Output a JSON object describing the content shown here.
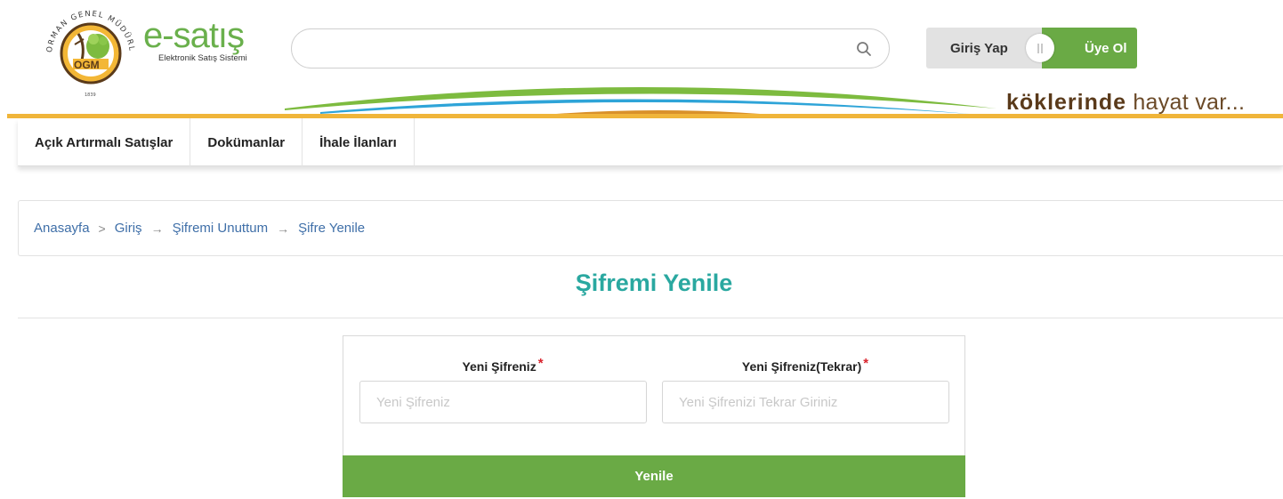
{
  "header": {
    "logo": {
      "emblem_text_top": "ORMAN GENEL MÜDÜRLÜĞÜ",
      "emblem_abbr": "OGM",
      "emblem_year": "1839",
      "brand": "e-satış",
      "subtitle": "Elektronik Satış Sistemi"
    },
    "search": {
      "value": "",
      "placeholder": "",
      "icon": "search-icon"
    },
    "auth": {
      "login_label": "Giriş Yap",
      "register_label": "Üye Ol"
    },
    "slogan": {
      "bold": "köklerinde",
      "light": "hayat var..."
    },
    "colors": {
      "accent_green": "#6aaa45",
      "gold": "#f0b53a",
      "title_teal": "#2aa8a0",
      "link_blue": "#3f6fa8"
    }
  },
  "nav": {
    "items": [
      {
        "label": "Açık Artırmalı Satışlar"
      },
      {
        "label": "Dokümanlar"
      },
      {
        "label": "İhale İlanları"
      }
    ]
  },
  "breadcrumb": {
    "items": [
      {
        "label": "Anasayfa"
      },
      {
        "label": "Giriş"
      },
      {
        "label": "Şifremi Unuttum"
      },
      {
        "label": "Şifre Yenile"
      }
    ],
    "separators": [
      ">",
      "→",
      "→"
    ]
  },
  "page": {
    "title": "Şifremi Yenile"
  },
  "form": {
    "password": {
      "label": "Yeni Şifreniz",
      "required_mark": "*",
      "value": "",
      "placeholder": "Yeni Şifreniz"
    },
    "password_confirm": {
      "label": "Yeni Şifreniz(Tekrar)",
      "required_mark": "*",
      "value": "",
      "placeholder": "Yeni Şifrenizi Tekrar Giriniz"
    },
    "submit_label": "Yenile"
  }
}
